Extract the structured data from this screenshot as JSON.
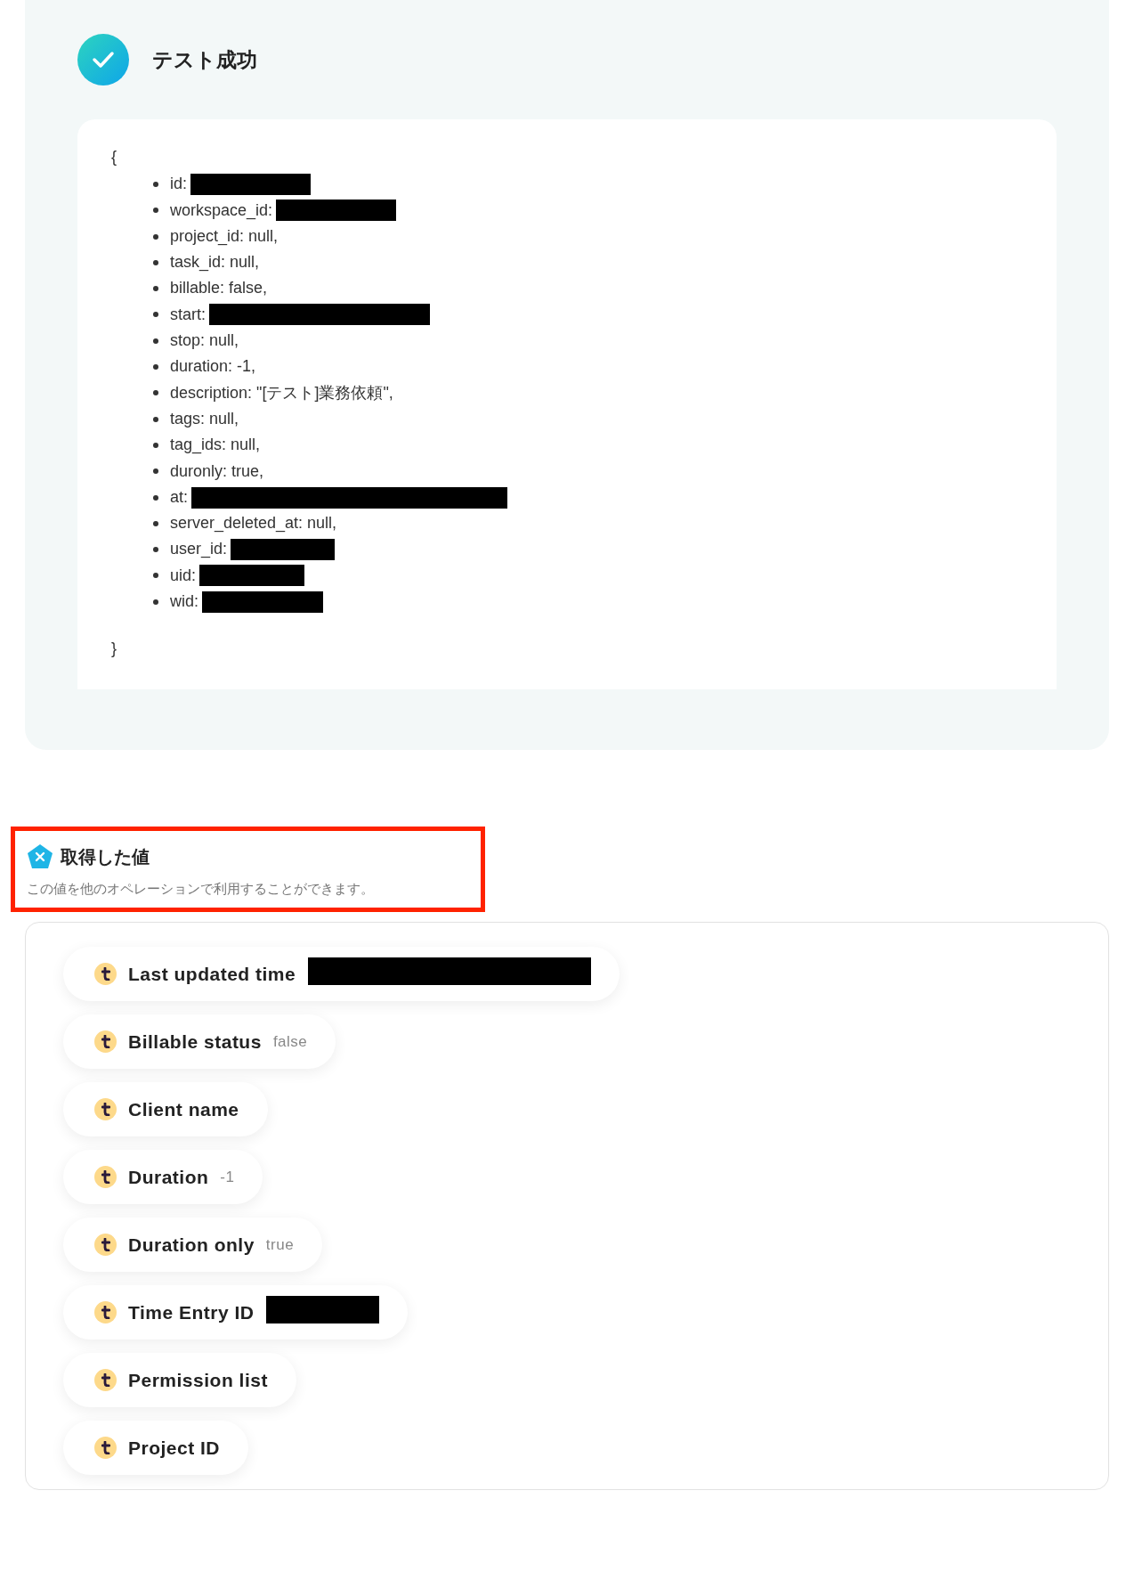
{
  "test_result": {
    "title": "テスト成功",
    "success": true,
    "open_brace": "{",
    "close_brace": "}",
    "fields": [
      {
        "text": "id:",
        "redacted": true
      },
      {
        "text": "workspace_id:",
        "redacted": true
      },
      {
        "text": "project_id: null,",
        "redacted": false
      },
      {
        "text": "task_id: null,",
        "redacted": false
      },
      {
        "text": "billable: false,",
        "redacted": false
      },
      {
        "text": "start:",
        "redacted": true
      },
      {
        "text": "stop: null,",
        "redacted": false
      },
      {
        "text": "duration: -1,",
        "redacted": false
      },
      {
        "text": "description: \"[テスト]業務依頼\",",
        "redacted": false
      },
      {
        "text": "tags: null,",
        "redacted": false
      },
      {
        "text": "tag_ids: null,",
        "redacted": false
      },
      {
        "text": "duronly: true,",
        "redacted": false
      },
      {
        "text": "at:",
        "redacted": true
      },
      {
        "text": "server_deleted_at: null,",
        "redacted": false
      },
      {
        "text": "user_id:",
        "redacted": true
      },
      {
        "text": "uid:",
        "redacted": true
      },
      {
        "text": "wid:",
        "redacted": true
      }
    ]
  },
  "values_section": {
    "title": "取得した値",
    "description": "この値を他のオペレーションで利用することができます。",
    "items": [
      {
        "label": "Last updated time",
        "redacted": true
      },
      {
        "label": "Billable status",
        "value": "false",
        "redacted": false
      },
      {
        "label": "Client name",
        "redacted": false
      },
      {
        "label": "Duration",
        "value": "-1",
        "redacted": false
      },
      {
        "label": "Duration only",
        "value": "true",
        "redacted": false
      },
      {
        "label": "Time Entry ID",
        "redacted": true
      },
      {
        "label": "Permission list",
        "redacted": false
      },
      {
        "label": "Project ID",
        "redacted": false
      }
    ]
  }
}
